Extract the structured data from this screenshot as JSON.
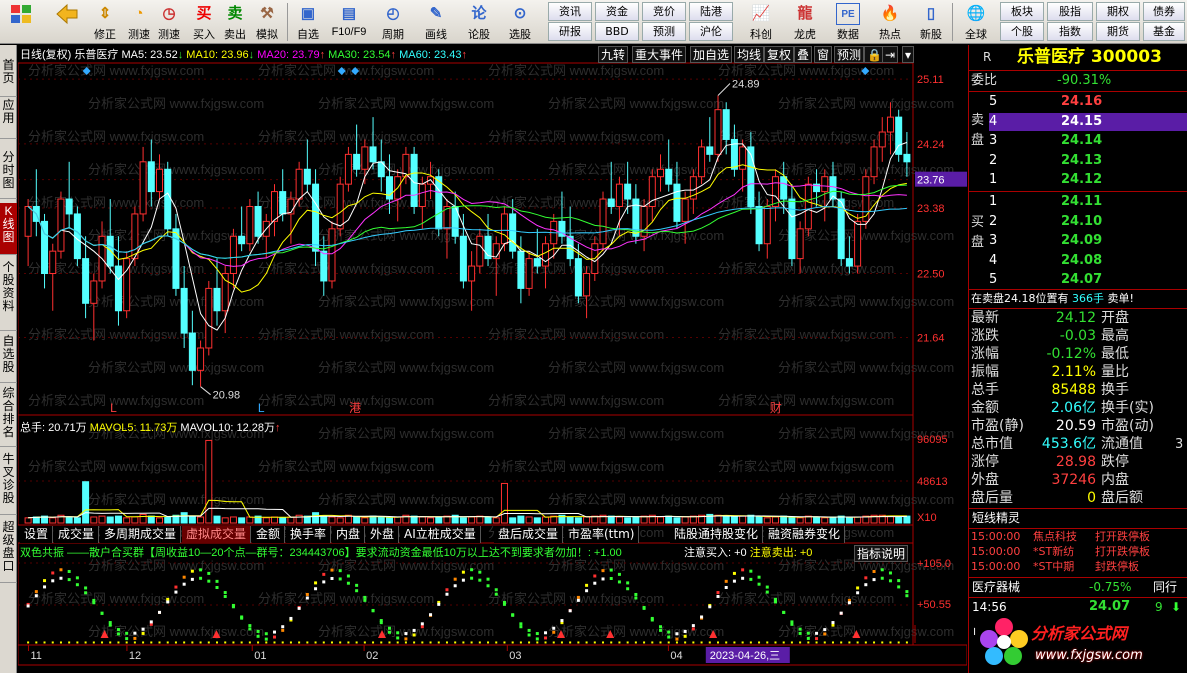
{
  "toolbar": {
    "big": [
      {
        "label": "",
        "icon": "home-grid-icon"
      },
      {
        "label": "",
        "icon": "back-arrow-icon"
      },
      {
        "label": "修正",
        "icon": "arrow-updown-icon"
      },
      {
        "label": "测速",
        "icon": "speed-icon"
      },
      {
        "label": "",
        "icon": "clock-icon"
      },
      {
        "label": "买入",
        "icon": "buy-icon"
      },
      {
        "label": "卖出",
        "icon": "sell-icon"
      },
      {
        "label": "模拟",
        "icon": "hammer-icon"
      },
      {
        "label": "自选",
        "icon": "star-icon"
      },
      {
        "label": "F10/F9",
        "icon": "f10-icon"
      },
      {
        "label": "周期",
        "icon": "cycle-icon"
      },
      {
        "label": "画线",
        "icon": "pencil-icon"
      },
      {
        "label": "论股",
        "icon": "talk-icon"
      },
      {
        "label": "选股",
        "icon": "search-chart-icon"
      },
      {
        "label": "科创",
        "icon": "chart-icon"
      },
      {
        "label": "龙虎",
        "icon": "dragon-icon"
      },
      {
        "label": "数据",
        "icon": "pe-icon"
      },
      {
        "label": "热点",
        "icon": "hot-icon"
      },
      {
        "label": "新股",
        "icon": "newstock-icon"
      },
      {
        "label": "全球",
        "icon": "globe-icon"
      }
    ],
    "small_row1": [
      "资讯",
      "资金",
      "竞价",
      "陆港",
      "板块",
      "股指",
      "期权",
      "债券"
    ],
    "small_row2": [
      "研报",
      "BBD",
      "预测",
      "沪伦",
      "个股",
      "指数",
      "期货",
      "基金"
    ],
    "buy_glyph": "买",
    "sell_glyph": "卖",
    "lun_glyph": "论"
  },
  "left_tabs": [
    "首页",
    "应用",
    "分时图",
    "K线图",
    "个股资料",
    "自选股",
    "综合排名",
    "牛叉诊股",
    "超级盘口"
  ],
  "chart": {
    "header": {
      "label": "日线(复权)",
      "name": "乐普医疗",
      "ma5": "MA5: 23.52",
      "ma10": "MA10: 23.96",
      "ma20": "MA20: 23.79",
      "ma30": "MA30: 23.54",
      "ma60": "MA60: 23.43",
      "ma5_arrow": "↓",
      "ma10_arrow": "↓",
      "ma20_arrow": "↑",
      "ma30_arrow": "↑",
      "ma60_arrow": "↑"
    },
    "top_buttons": [
      "九转",
      "重大事件",
      "加自选",
      "均线",
      "复权",
      "叠",
      "窗",
      "预测"
    ],
    "price_axis": [
      "25.11",
      "24.24",
      "23.76",
      "23.38",
      "22.50",
      "21.64"
    ],
    "high_label": "24.89",
    "low_label": "20.98",
    "markers": [
      "L",
      "L",
      "港",
      "财"
    ],
    "vol_header": {
      "total": "总手: 20.71万",
      "mavol5": "MAVOL5: 11.73万",
      "mavol10": "MAVOL10: 12.28万",
      "arrow": "↑"
    },
    "vol_axis": [
      "96095",
      "48613",
      "X10"
    ],
    "panel_tabs": [
      "设置",
      "成交量",
      "多周期成交量",
      "虚拟成交量",
      "金额",
      "换手率",
      "内盘",
      "外盘",
      "AI立桩成交量",
      "盘后成交量",
      "市盈率(ttm)",
      "陆股通持股变化",
      "融资融券变化"
    ],
    "panel_active": 3,
    "ind_header": "双色共振 ——散户合买群【周收益10—20个点—群号：234443706】要求流动资金最低10万以上达不到要求者勿加！: +1.00",
    "ind_buy": "注意买入: +0",
    "ind_sell": "注意卖出: +0",
    "ind_button": "指标说明",
    "ind_axis": [
      "+105.0",
      "+50.55"
    ],
    "date_axis": [
      "11",
      "12",
      "01",
      "02",
      "03",
      "04"
    ],
    "date_cursor": "2023-04-26,三",
    "watermark": "分析家公式网 www.fxjgsw.com",
    "chart_data": {
      "type": "candlestick",
      "ylim": [
        20.6,
        25.3
      ],
      "high": 24.89,
      "low": 20.98,
      "ma_colors": {
        "MA5": "#ffffff",
        "MA10": "#ffff00",
        "MA20": "#ff33ff",
        "MA30": "#33ff33",
        "MA60": "#33ccff"
      },
      "candles": [
        [
          23.0,
          23.5,
          22.6,
          23.4
        ],
        [
          23.4,
          23.9,
          23.0,
          23.2
        ],
        [
          23.2,
          23.3,
          22.3,
          22.5
        ],
        [
          22.5,
          22.9,
          22.0,
          22.8
        ],
        [
          22.8,
          23.6,
          22.7,
          23.5
        ],
        [
          23.5,
          24.0,
          23.1,
          23.3
        ],
        [
          23.3,
          23.4,
          22.6,
          22.7
        ],
        [
          22.7,
          23.0,
          21.9,
          22.1
        ],
        [
          22.1,
          22.5,
          21.6,
          22.4
        ],
        [
          22.4,
          23.2,
          22.3,
          23.0
        ],
        [
          23.0,
          23.5,
          22.5,
          22.6
        ],
        [
          22.6,
          23.0,
          21.8,
          22.0
        ],
        [
          22.0,
          22.8,
          21.9,
          22.7
        ],
        [
          22.7,
          23.4,
          22.6,
          23.3
        ],
        [
          23.3,
          24.2,
          23.2,
          24.0
        ],
        [
          24.0,
          24.3,
          23.4,
          23.6
        ],
        [
          23.6,
          24.1,
          23.5,
          23.9
        ],
        [
          23.9,
          24.0,
          23.0,
          23.1
        ],
        [
          23.1,
          23.3,
          22.2,
          22.3
        ],
        [
          22.3,
          22.6,
          21.5,
          21.7
        ],
        [
          21.7,
          22.0,
          21.0,
          21.2
        ],
        [
          21.2,
          21.6,
          20.98,
          21.5
        ],
        [
          21.5,
          22.4,
          21.4,
          22.3
        ],
        [
          22.3,
          22.7,
          21.8,
          22.0
        ],
        [
          22.0,
          22.6,
          21.7,
          22.5
        ],
        [
          22.5,
          23.1,
          22.3,
          23.0
        ],
        [
          23.0,
          23.4,
          22.8,
          22.9
        ],
        [
          22.9,
          23.5,
          22.8,
          23.4
        ],
        [
          23.4,
          23.6,
          22.9,
          23.0
        ],
        [
          23.0,
          23.3,
          22.7,
          23.2
        ],
        [
          23.2,
          23.7,
          23.0,
          23.6
        ],
        [
          23.6,
          23.9,
          23.2,
          23.3
        ],
        [
          23.3,
          23.6,
          22.9,
          23.5
        ],
        [
          23.5,
          24.0,
          23.4,
          23.9
        ],
        [
          23.9,
          24.3,
          23.6,
          23.7
        ],
        [
          23.7,
          23.9,
          22.6,
          22.8
        ],
        [
          22.8,
          23.0,
          22.2,
          22.4
        ],
        [
          22.4,
          23.2,
          22.3,
          23.1
        ],
        [
          23.1,
          23.8,
          23.0,
          23.7
        ],
        [
          23.7,
          24.2,
          23.6,
          24.1
        ],
        [
          24.1,
          24.5,
          23.8,
          23.9
        ],
        [
          23.9,
          24.3,
          23.7,
          24.2
        ],
        [
          24.2,
          24.6,
          23.9,
          24.0
        ],
        [
          24.0,
          24.3,
          23.6,
          23.8
        ],
        [
          23.8,
          24.1,
          23.3,
          23.5
        ],
        [
          23.5,
          23.9,
          23.2,
          23.8
        ],
        [
          23.8,
          24.2,
          23.7,
          24.1
        ],
        [
          24.1,
          24.2,
          23.3,
          23.4
        ],
        [
          23.4,
          23.8,
          23.1,
          23.7
        ],
        [
          23.7,
          24.0,
          23.5,
          23.8
        ],
        [
          23.8,
          23.9,
          23.0,
          23.1
        ],
        [
          23.1,
          23.5,
          22.7,
          23.4
        ],
        [
          23.4,
          23.6,
          22.9,
          23.0
        ],
        [
          23.0,
          23.3,
          22.3,
          22.4
        ],
        [
          22.4,
          22.8,
          22.0,
          22.6
        ],
        [
          22.6,
          23.1,
          22.5,
          23.0
        ],
        [
          23.0,
          23.3,
          22.6,
          22.7
        ],
        [
          22.7,
          23.0,
          22.2,
          22.9
        ],
        [
          22.9,
          23.4,
          22.8,
          23.3
        ],
        [
          23.3,
          23.5,
          22.7,
          22.8
        ],
        [
          22.8,
          23.0,
          22.1,
          22.3
        ],
        [
          22.3,
          22.8,
          22.2,
          22.7
        ],
        [
          22.7,
          23.1,
          22.5,
          22.6
        ],
        [
          22.6,
          23.0,
          22.3,
          22.9
        ],
        [
          22.9,
          23.3,
          22.7,
          23.2
        ],
        [
          23.2,
          23.6,
          22.9,
          23.0
        ],
        [
          23.0,
          23.4,
          22.6,
          22.7
        ],
        [
          22.7,
          22.9,
          22.1,
          22.2
        ],
        [
          22.2,
          22.6,
          21.9,
          22.5
        ],
        [
          22.5,
          23.0,
          22.4,
          22.9
        ],
        [
          22.9,
          23.6,
          22.8,
          23.5
        ],
        [
          23.5,
          24.0,
          23.3,
          23.4
        ],
        [
          23.4,
          23.8,
          23.0,
          23.7
        ],
        [
          23.7,
          24.0,
          23.3,
          23.5
        ],
        [
          23.5,
          23.7,
          22.9,
          23.0
        ],
        [
          23.0,
          23.5,
          22.8,
          23.4
        ],
        [
          23.4,
          23.9,
          23.2,
          23.8
        ],
        [
          23.8,
          24.1,
          23.6,
          23.9
        ],
        [
          23.9,
          24.3,
          23.6,
          23.7
        ],
        [
          23.7,
          24.0,
          23.1,
          23.2
        ],
        [
          23.2,
          23.6,
          22.9,
          23.5
        ],
        [
          23.5,
          23.9,
          23.3,
          23.8
        ],
        [
          23.8,
          24.3,
          23.7,
          24.2
        ],
        [
          24.2,
          24.6,
          24.0,
          24.1
        ],
        [
          24.1,
          24.89,
          24.0,
          24.7
        ],
        [
          24.7,
          24.8,
          24.1,
          24.3
        ],
        [
          24.3,
          24.5,
          23.8,
          23.9
        ],
        [
          23.9,
          24.3,
          23.6,
          24.2
        ],
        [
          24.2,
          24.4,
          23.3,
          23.4
        ],
        [
          23.4,
          23.6,
          22.8,
          22.9
        ],
        [
          22.9,
          23.5,
          22.7,
          23.4
        ],
        [
          23.4,
          23.9,
          23.2,
          23.8
        ],
        [
          23.8,
          24.0,
          23.3,
          23.5
        ],
        [
          23.5,
          23.7,
          22.6,
          22.7
        ],
        [
          22.7,
          23.2,
          22.5,
          23.1
        ],
        [
          23.1,
          23.8,
          23.0,
          23.7
        ],
        [
          23.7,
          23.9,
          23.4,
          23.6
        ],
        [
          23.6,
          23.9,
          23.2,
          23.8
        ],
        [
          23.8,
          24.0,
          23.4,
          23.5
        ],
        [
          23.5,
          23.6,
          22.6,
          22.7
        ],
        [
          22.7,
          23.0,
          22.5,
          22.6
        ],
        [
          22.6,
          23.3,
          22.5,
          23.2
        ],
        [
          23.2,
          23.9,
          23.1,
          23.8
        ],
        [
          23.8,
          24.3,
          23.7,
          24.2
        ],
        [
          24.2,
          24.6,
          24.0,
          24.4
        ],
        [
          24.4,
          24.8,
          24.1,
          24.6
        ],
        [
          24.6,
          24.7,
          24.0,
          24.1
        ],
        [
          24.1,
          24.4,
          23.8,
          24.0
        ]
      ],
      "volumes": [
        6,
        7,
        8,
        6,
        9,
        7,
        6,
        9,
        7,
        8,
        7,
        8,
        6,
        7,
        10,
        8,
        6,
        7,
        9,
        12,
        8,
        7,
        9,
        8,
        6,
        7,
        6,
        7,
        8,
        6,
        7,
        6,
        7,
        9,
        8,
        12,
        8,
        7,
        6,
        9,
        7,
        6,
        8,
        7,
        6,
        7,
        9,
        8,
        7,
        6,
        7,
        8,
        9,
        6,
        7,
        8,
        7,
        6,
        7,
        6,
        8,
        7,
        6,
        7,
        8,
        9,
        7,
        6,
        7,
        8,
        9,
        8,
        7,
        6,
        7,
        8,
        9,
        7,
        8,
        6,
        7,
        8,
        9,
        10,
        9,
        8,
        7,
        8,
        9,
        7,
        6,
        7,
        8,
        7,
        6,
        8,
        7,
        6,
        7,
        8,
        6,
        7,
        8,
        9,
        9,
        8,
        7,
        8
      ],
      "vol_spikes": [
        [
          7,
          48
        ],
        [
          22,
          96
        ],
        [
          58,
          46
        ]
      ]
    }
  },
  "quote": {
    "title": "乐普医疗",
    "code": "300003",
    "r": "R",
    "weibi_label": "委比",
    "weibi": "-90.31%",
    "sell_label": "卖盘",
    "buy_label": "买盘",
    "sells": [
      {
        "n": "5",
        "p": "24.16"
      },
      {
        "n": "4",
        "p": "24.15"
      },
      {
        "n": "3",
        "p": "24.14"
      },
      {
        "n": "2",
        "p": "24.13"
      },
      {
        "n": "1",
        "p": "24.12"
      }
    ],
    "buys": [
      {
        "n": "1",
        "p": "24.11"
      },
      {
        "n": "2",
        "p": "24.10"
      },
      {
        "n": "3",
        "p": "24.09"
      },
      {
        "n": "4",
        "p": "24.08"
      },
      {
        "n": "5",
        "p": "24.07"
      }
    ],
    "notice": "在卖盘24.18位置有",
    "notice_qty": "366手",
    "notice_tag": "卖单!",
    "rows": [
      {
        "l": "最新",
        "v": "24.12",
        "c": "dn",
        "l2": "开盘"
      },
      {
        "l": "涨跌",
        "v": "-0.03",
        "c": "dn",
        "l2": "最高"
      },
      {
        "l": "涨幅",
        "v": "-0.12%",
        "c": "dn",
        "l2": "最低"
      },
      {
        "l": "振幅",
        "v": "2.11%",
        "c": "ye",
        "l2": "量比"
      },
      {
        "l": "总手",
        "v": "85488",
        "c": "ye",
        "l2": "换手"
      },
      {
        "l": "金额",
        "v": "2.06亿",
        "c": "cy",
        "l2": "换手(实)"
      },
      {
        "l": "市盈(静)",
        "v": "20.59",
        "c": "wt",
        "l2": "市盈(动)"
      },
      {
        "l": "总市值",
        "v": "453.6亿",
        "c": "cy",
        "l2": "流通值"
      },
      {
        "l": "涨停",
        "v": "28.98",
        "c": "up",
        "l2": "跌停"
      },
      {
        "l": "外盘",
        "v": "37246",
        "c": "up",
        "l2": "内盘"
      },
      {
        "l": "盘后量",
        "v": "0",
        "c": "ye",
        "l2": "盘后额"
      }
    ],
    "liutong_tail": "3",
    "short_title": "短线精灵",
    "short_rows": [
      {
        "t": "15:00:00",
        "n": "焦点科技",
        "e": "打开跌停板"
      },
      {
        "t": "15:00:00",
        "n": "*ST新纺",
        "e": "打开跌停板"
      },
      {
        "t": "15:00:00",
        "n": "*ST中期",
        "e": "封跌停板"
      }
    ],
    "sector": "医疗器械",
    "sector_pct": "-0.75%",
    "sector_btn": "同行",
    "tick_time": "14:56",
    "tick_price": "24.07",
    "tick_vol": "9",
    "logo_cn": "分析家公式网",
    "logo_url": "www.fxjgsw.com"
  }
}
